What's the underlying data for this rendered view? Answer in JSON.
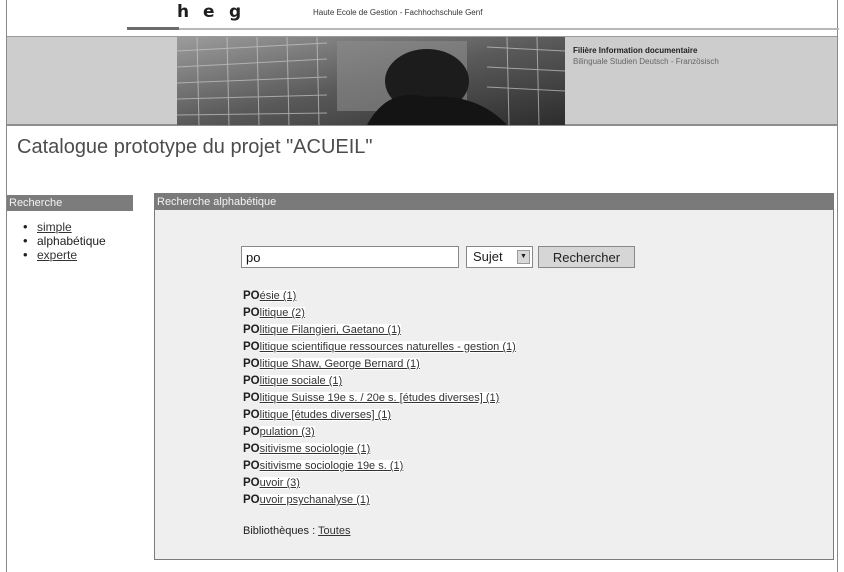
{
  "header": {
    "logo_letters": [
      "h",
      "e",
      "g"
    ],
    "school": "Haute Ecole de Gestion - Fachhochschule Genf",
    "banner_line1": "Filière Information documentaire",
    "banner_line2": "Bilinguale Studien Deutsch - Französisch"
  },
  "page_title": "Catalogue prototype du projet \"ACUEIL\"",
  "sidebar": {
    "heading": "Recherche",
    "items": [
      {
        "label": "simple",
        "link": true
      },
      {
        "label": "alphabétique",
        "link": false
      },
      {
        "label": "experte",
        "link": true
      }
    ]
  },
  "main": {
    "heading": "Recherche alphabétique",
    "search": {
      "value": "po"
    },
    "select": {
      "selected": "Sujet"
    },
    "submit_label": "Rechercher",
    "results": [
      {
        "prefix": "PO",
        "rest": "ésie (1)"
      },
      {
        "prefix": "PO",
        "rest": "litique (2)"
      },
      {
        "prefix": "PO",
        "rest": "litique Filangieri, Gaetano (1)"
      },
      {
        "prefix": "PO",
        "rest": "litique scientifique ressources naturelles - gestion (1)"
      },
      {
        "prefix": "PO",
        "rest": "litique Shaw, George Bernard (1)"
      },
      {
        "prefix": "PO",
        "rest": "litique sociale (1)"
      },
      {
        "prefix": "PO",
        "rest": "litique Suisse 19e s. / 20e s. [études diverses] (1)"
      },
      {
        "prefix": "PO",
        "rest": "litique [études diverses] (1)"
      },
      {
        "prefix": "PO",
        "rest": "pulation (3)"
      },
      {
        "prefix": "PO",
        "rest": "sitivisme sociologie (1)"
      },
      {
        "prefix": "PO",
        "rest": "sitivisme sociologie 19e s. (1)"
      },
      {
        "prefix": "PO",
        "rest": "uvoir (3)"
      },
      {
        "prefix": "PO",
        "rest": "uvoir psychanalyse (1)"
      }
    ],
    "libraries_label": "Bibliothèques : ",
    "libraries_link": "Toutes"
  }
}
